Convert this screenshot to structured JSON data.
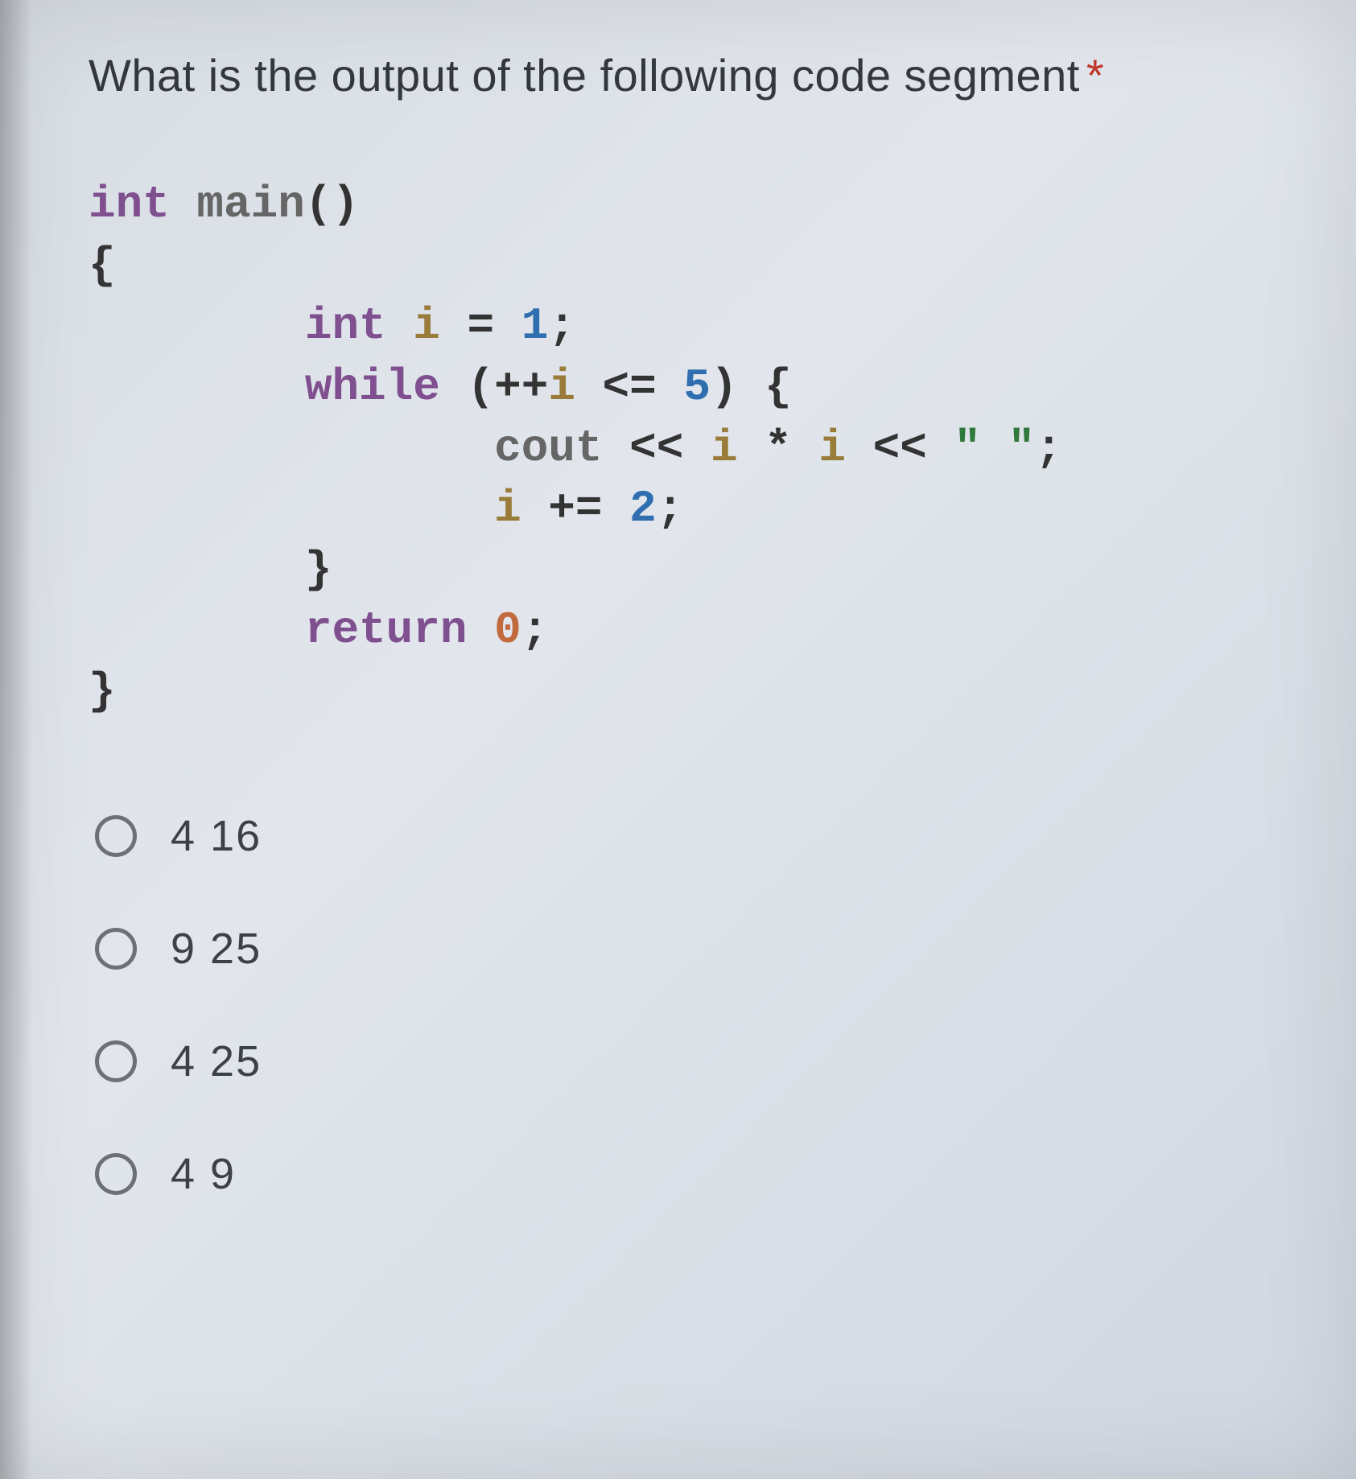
{
  "question": {
    "text": "What is the output of the following code segment",
    "required": true
  },
  "code": {
    "lines": [
      [
        {
          "t": "int ",
          "cls": "kw-type"
        },
        {
          "t": "main",
          "cls": "ident"
        },
        {
          "t": "()",
          "cls": "punct"
        }
      ],
      [
        {
          "t": "{",
          "cls": "brace"
        }
      ],
      [
        {
          "t": "        ",
          "cls": ""
        },
        {
          "t": "int ",
          "cls": "kw-type"
        },
        {
          "t": "i",
          "cls": "varname"
        },
        {
          "t": " = ",
          "cls": "punct"
        },
        {
          "t": "1",
          "cls": "num"
        },
        {
          "t": ";",
          "cls": "punct"
        }
      ],
      [
        {
          "t": "        ",
          "cls": ""
        },
        {
          "t": "while ",
          "cls": "kw-control"
        },
        {
          "t": "(++",
          "cls": "punct"
        },
        {
          "t": "i",
          "cls": "varname"
        },
        {
          "t": " <= ",
          "cls": "punct"
        },
        {
          "t": "5",
          "cls": "num"
        },
        {
          "t": ") {",
          "cls": "punct"
        }
      ],
      [
        {
          "t": "               ",
          "cls": ""
        },
        {
          "t": "cout",
          "cls": "ident"
        },
        {
          "t": " << ",
          "cls": "punct"
        },
        {
          "t": "i",
          "cls": "varname"
        },
        {
          "t": " * ",
          "cls": "punct"
        },
        {
          "t": "i",
          "cls": "varname"
        },
        {
          "t": " << ",
          "cls": "punct"
        },
        {
          "t": "\" \"",
          "cls": "str"
        },
        {
          "t": ";",
          "cls": "punct"
        }
      ],
      [
        {
          "t": "               ",
          "cls": ""
        },
        {
          "t": "i",
          "cls": "varname"
        },
        {
          "t": " += ",
          "cls": "punct"
        },
        {
          "t": "2",
          "cls": "num"
        },
        {
          "t": ";",
          "cls": "punct"
        }
      ],
      [
        {
          "t": "        }",
          "cls": "brace"
        }
      ],
      [
        {
          "t": "        ",
          "cls": ""
        },
        {
          "t": "return ",
          "cls": "kw-control"
        },
        {
          "t": "0",
          "cls": "num-zero"
        },
        {
          "t": ";",
          "cls": "punct"
        }
      ],
      [
        {
          "t": "}",
          "cls": "brace"
        }
      ]
    ]
  },
  "options": [
    {
      "label": "4 16"
    },
    {
      "label": "9 25"
    },
    {
      "label": "4 25"
    },
    {
      "label": "4 9"
    }
  ]
}
